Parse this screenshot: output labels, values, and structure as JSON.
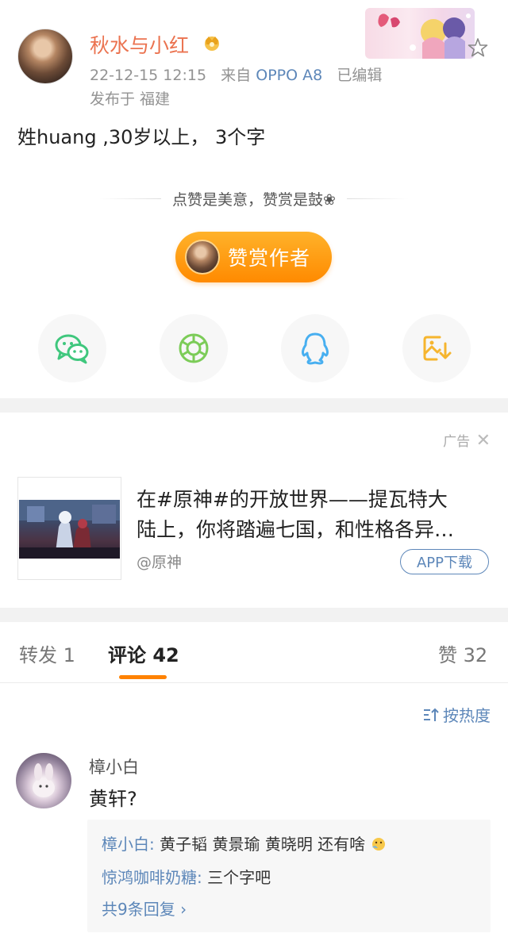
{
  "post": {
    "username": "秋水与小红",
    "timestamp": "22-12-15 12:15",
    "source_prefix": "来自",
    "device": "OPPO A8",
    "edited": "已编辑",
    "location": "发布于 福建",
    "text": "姓huang ,30岁以上， 3个字",
    "tip": "点赞是美意，赞赏是鼓❀",
    "reward_label": "赞赏作者",
    "share_icons": [
      "wechat-icon",
      "moments-icon",
      "qq-icon",
      "save-image-icon"
    ]
  },
  "ad": {
    "tag": "广告",
    "title_line1": "在#原神#的开放世界——提瓦特大",
    "title_line2": "陆上，你将踏遍七国，和性格各异…",
    "source": "@原神",
    "cta": "APP下载"
  },
  "tabs": [
    {
      "label": "转发 1"
    },
    {
      "label": "评论 42"
    },
    {
      "label": "赞 32"
    }
  ],
  "sort_label": "按热度",
  "comment": {
    "author": "樟小白",
    "text": "黄轩?",
    "replies": [
      {
        "who": "樟小白:",
        "text": " 黄子韬 黄景瑜 黄晓明 还有啥"
      },
      {
        "who": "惊鸿咖啡奶糖:",
        "text": " 三个字吧"
      }
    ],
    "more": "共9条回复 ›"
  },
  "colors": {
    "accent_orange": "#ff8200",
    "username_orange": "#eb7350",
    "link_blue": "#5d87b9",
    "wechat_green": "#3fc77d",
    "moments_green": "#7ccc58",
    "qq_blue": "#48aff0",
    "save_orange": "#f6b52e"
  }
}
